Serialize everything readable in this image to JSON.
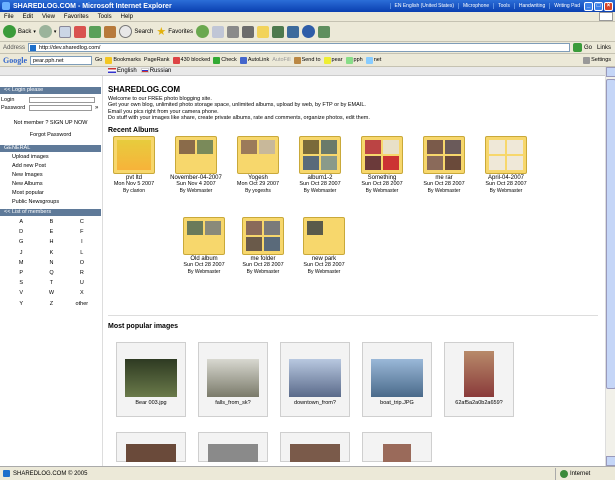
{
  "window": {
    "title": "SHAREDLOG.COM - Microsoft Internet Explorer",
    "tray": [
      "EN English (United States)",
      "Microphone",
      "Tools",
      "Handwriting",
      "Writing Pad"
    ]
  },
  "menu": [
    "File",
    "Edit",
    "View",
    "Favorites",
    "Tools",
    "Help"
  ],
  "toolbar": {
    "back": "Back",
    "search": "Search",
    "favorites": "Favorites"
  },
  "address": {
    "label": "Address",
    "url": "http://dev.sharedlog.com/",
    "go": "Go",
    "links": "Links"
  },
  "google": {
    "logo": "Google",
    "query": "pear.pph.net",
    "go": "Go",
    "items": [
      "Bookmarks",
      "PageRank",
      "430 blocked",
      "Check",
      "AutoLink",
      "AutoFill",
      "Send to",
      "pear",
      "pph",
      "net"
    ],
    "settings": "Settings"
  },
  "lang": {
    "english": "English",
    "russian": "Russian"
  },
  "sidebar": {
    "login_header": "Login please",
    "login_label": "Login",
    "password_label": "Password",
    "not_member": "Not member ? SIGN UP NOW",
    "forgot": "Forgot Password",
    "general_header": "GENERAL",
    "general_items": [
      "Upload images",
      "Add new Post",
      "New Images",
      "New Albums",
      "Most popular",
      "Public Newsgroups"
    ],
    "members_header": "List of members",
    "letters": [
      "A",
      "B",
      "C",
      "D",
      "E",
      "F",
      "G",
      "H",
      "I",
      "J",
      "K",
      "L",
      "M",
      "N",
      "O",
      "P",
      "Q",
      "R",
      "S",
      "T",
      "U",
      "V",
      "W",
      "X",
      "Y",
      "Z",
      "other"
    ]
  },
  "main": {
    "site_title": "SHAREDLOG.COM",
    "welcome_lines": [
      "Welcome to our FREE photo blogging site.",
      "Get your own blog, unlimited photo storage space, unlimited albums, upload by web, by FTP or by EMAIL.",
      "Email you pics right from your camera phone.",
      "Do stuff with your images like share, create private albums, rate and comments, organize photos, edit them."
    ],
    "recent_albums_title": "Recent Albums",
    "albums": [
      {
        "name": "pvt ltd",
        "date": "Mon Nov 5 2007",
        "by": "By clarion"
      },
      {
        "name": "November-04-2007",
        "date": "Sun Nov 4 2007",
        "by": "By Webmaster"
      },
      {
        "name": "Yogesh",
        "date": "Mon Oct 29 2007",
        "by": "By yogeshs"
      },
      {
        "name": "album1-2",
        "date": "Sun Oct 28 2007",
        "by": "By Webmaster"
      },
      {
        "name": "Something",
        "date": "Sun Oct 28 2007",
        "by": "By Webmaster"
      },
      {
        "name": "me rar",
        "date": "Sun Oct 28 2007",
        "by": "By Webmaster"
      },
      {
        "name": "April-04-2007",
        "date": "Sun Oct 28 2007",
        "by": "By Webmaster"
      },
      {
        "name": "Old album",
        "date": "Sun Oct 28 2007",
        "by": "By Webmaster"
      },
      {
        "name": "me folder",
        "date": "Sun Oct 28 2007",
        "by": "By Webmaster"
      },
      {
        "name": "new park",
        "date": "Sun Oct 28 2007",
        "by": "By Webmaster"
      }
    ],
    "popular_title": "Most popular images",
    "popular": [
      {
        "caption": "Bear 003.jpg"
      },
      {
        "caption": "falls_from_sk?"
      },
      {
        "caption": "downtown_from?"
      },
      {
        "caption": "boat_trip.JPG"
      },
      {
        "caption": "62af5a2a0b2a659?"
      }
    ]
  },
  "status": {
    "text": "SHAREDLOG.COM © 2005",
    "zone": "Internet"
  },
  "colors": {
    "sidebar_header": "#5f7a99",
    "folder": "#f7d76c",
    "title_bar": "#0a3fb0"
  }
}
